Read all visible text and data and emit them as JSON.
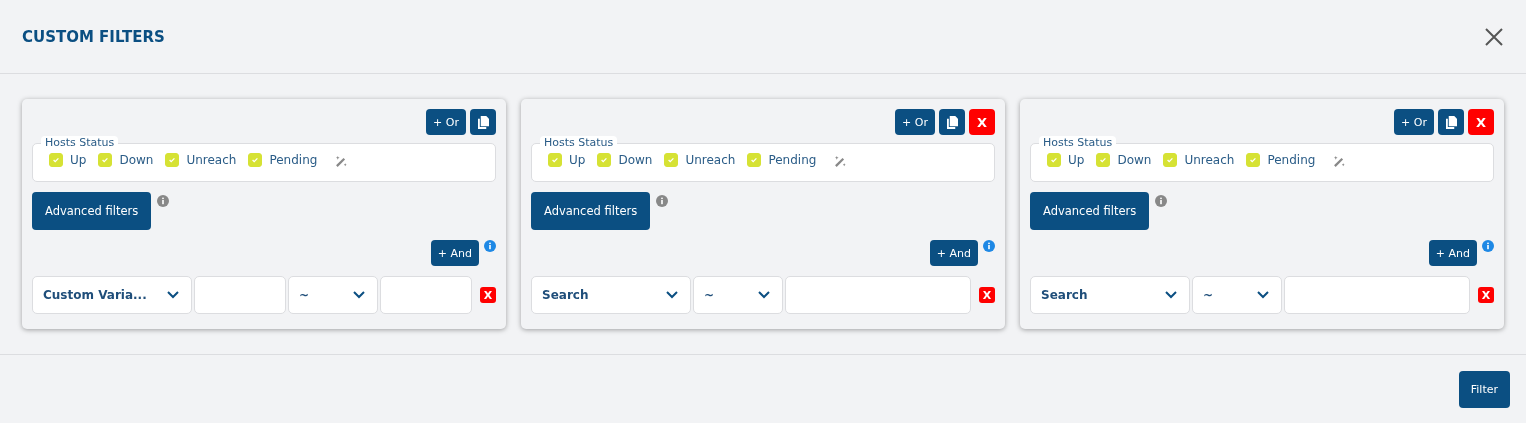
{
  "dialog": {
    "title": "CUSTOM FILTERS"
  },
  "cards": [
    {
      "or_button": "+ Or",
      "removable": false,
      "status_legend": "Hosts Status",
      "statuses": [
        {
          "label": "Up",
          "checked": true
        },
        {
          "label": "Down",
          "checked": true
        },
        {
          "label": "Unreach",
          "checked": true
        },
        {
          "label": "Pending",
          "checked": true
        }
      ],
      "advanced_button": "Advanced filters",
      "and_button": "+ And",
      "remove_row_label": "X",
      "fields": [
        {
          "kind": "select",
          "value": "Custom Varia..."
        },
        {
          "kind": "input"
        },
        {
          "kind": "select",
          "value": "~"
        },
        {
          "kind": "input"
        }
      ]
    },
    {
      "or_button": "+ Or",
      "removable": true,
      "remove_label": "X",
      "status_legend": "Hosts Status",
      "statuses": [
        {
          "label": "Up",
          "checked": true
        },
        {
          "label": "Down",
          "checked": true
        },
        {
          "label": "Unreach",
          "checked": true
        },
        {
          "label": "Pending",
          "checked": true
        }
      ],
      "advanced_button": "Advanced filters",
      "and_button": "+ And",
      "remove_row_label": "X",
      "fields": [
        {
          "kind": "select",
          "value": "Search"
        },
        {
          "kind": "select",
          "value": "~"
        },
        {
          "kind": "input"
        }
      ]
    },
    {
      "or_button": "+ Or",
      "removable": true,
      "remove_label": "X",
      "status_legend": "Hosts Status",
      "statuses": [
        {
          "label": "Up",
          "checked": true
        },
        {
          "label": "Down",
          "checked": true
        },
        {
          "label": "Unreach",
          "checked": true
        },
        {
          "label": "Pending",
          "checked": true
        }
      ],
      "advanced_button": "Advanced filters",
      "and_button": "+ And",
      "remove_row_label": "X",
      "fields": [
        {
          "kind": "select",
          "value": "Search"
        },
        {
          "kind": "select",
          "value": "~"
        },
        {
          "kind": "input"
        }
      ]
    }
  ],
  "footer": {
    "filter_button": "Filter"
  }
}
